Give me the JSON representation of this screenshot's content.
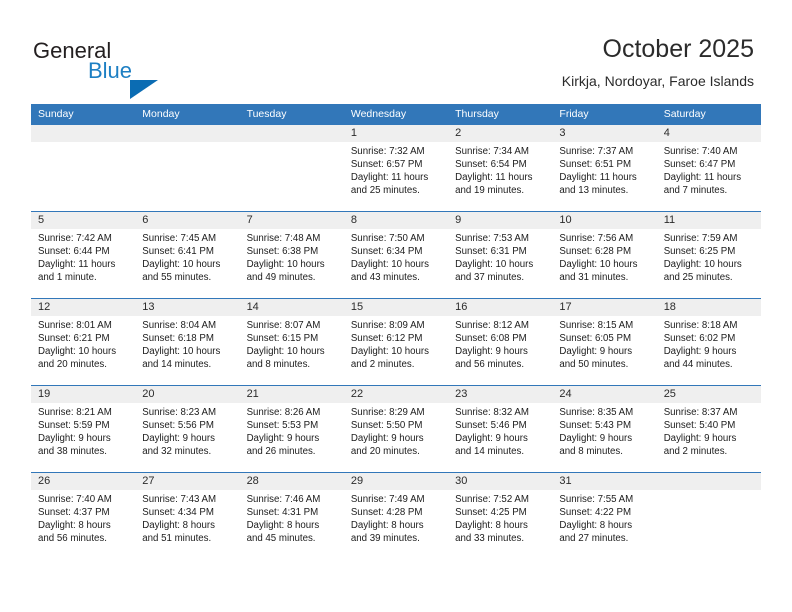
{
  "brand": {
    "name_part1": "General",
    "name_part2": "Blue",
    "logo_icon": "triangle-icon",
    "accent_color": "#1d7fc3",
    "triangle_color": "#0b6cb3"
  },
  "header": {
    "title": "October 2025",
    "subtitle": "Kirkja, Nordoyar, Faroe Islands"
  },
  "theme": {
    "header_blue": "#3277b9",
    "daynum_band": "#efefef",
    "text": "#1c1c1c"
  },
  "weekday_headers": [
    "Sunday",
    "Monday",
    "Tuesday",
    "Wednesday",
    "Thursday",
    "Friday",
    "Saturday"
  ],
  "weeks": [
    [
      {
        "day": "",
        "lines": []
      },
      {
        "day": "",
        "lines": []
      },
      {
        "day": "",
        "lines": []
      },
      {
        "day": "1",
        "lines": [
          "Sunrise: 7:32 AM",
          "Sunset: 6:57 PM",
          "Daylight: 11 hours",
          "and 25 minutes."
        ]
      },
      {
        "day": "2",
        "lines": [
          "Sunrise: 7:34 AM",
          "Sunset: 6:54 PM",
          "Daylight: 11 hours",
          "and 19 minutes."
        ]
      },
      {
        "day": "3",
        "lines": [
          "Sunrise: 7:37 AM",
          "Sunset: 6:51 PM",
          "Daylight: 11 hours",
          "and 13 minutes."
        ]
      },
      {
        "day": "4",
        "lines": [
          "Sunrise: 7:40 AM",
          "Sunset: 6:47 PM",
          "Daylight: 11 hours",
          "and 7 minutes."
        ]
      }
    ],
    [
      {
        "day": "5",
        "lines": [
          "Sunrise: 7:42 AM",
          "Sunset: 6:44 PM",
          "Daylight: 11 hours",
          "and 1 minute."
        ]
      },
      {
        "day": "6",
        "lines": [
          "Sunrise: 7:45 AM",
          "Sunset: 6:41 PM",
          "Daylight: 10 hours",
          "and 55 minutes."
        ]
      },
      {
        "day": "7",
        "lines": [
          "Sunrise: 7:48 AM",
          "Sunset: 6:38 PM",
          "Daylight: 10 hours",
          "and 49 minutes."
        ]
      },
      {
        "day": "8",
        "lines": [
          "Sunrise: 7:50 AM",
          "Sunset: 6:34 PM",
          "Daylight: 10 hours",
          "and 43 minutes."
        ]
      },
      {
        "day": "9",
        "lines": [
          "Sunrise: 7:53 AM",
          "Sunset: 6:31 PM",
          "Daylight: 10 hours",
          "and 37 minutes."
        ]
      },
      {
        "day": "10",
        "lines": [
          "Sunrise: 7:56 AM",
          "Sunset: 6:28 PM",
          "Daylight: 10 hours",
          "and 31 minutes."
        ]
      },
      {
        "day": "11",
        "lines": [
          "Sunrise: 7:59 AM",
          "Sunset: 6:25 PM",
          "Daylight: 10 hours",
          "and 25 minutes."
        ]
      }
    ],
    [
      {
        "day": "12",
        "lines": [
          "Sunrise: 8:01 AM",
          "Sunset: 6:21 PM",
          "Daylight: 10 hours",
          "and 20 minutes."
        ]
      },
      {
        "day": "13",
        "lines": [
          "Sunrise: 8:04 AM",
          "Sunset: 6:18 PM",
          "Daylight: 10 hours",
          "and 14 minutes."
        ]
      },
      {
        "day": "14",
        "lines": [
          "Sunrise: 8:07 AM",
          "Sunset: 6:15 PM",
          "Daylight: 10 hours",
          "and 8 minutes."
        ]
      },
      {
        "day": "15",
        "lines": [
          "Sunrise: 8:09 AM",
          "Sunset: 6:12 PM",
          "Daylight: 10 hours",
          "and 2 minutes."
        ]
      },
      {
        "day": "16",
        "lines": [
          "Sunrise: 8:12 AM",
          "Sunset: 6:08 PM",
          "Daylight: 9 hours",
          "and 56 minutes."
        ]
      },
      {
        "day": "17",
        "lines": [
          "Sunrise: 8:15 AM",
          "Sunset: 6:05 PM",
          "Daylight: 9 hours",
          "and 50 minutes."
        ]
      },
      {
        "day": "18",
        "lines": [
          "Sunrise: 8:18 AM",
          "Sunset: 6:02 PM",
          "Daylight: 9 hours",
          "and 44 minutes."
        ]
      }
    ],
    [
      {
        "day": "19",
        "lines": [
          "Sunrise: 8:21 AM",
          "Sunset: 5:59 PM",
          "Daylight: 9 hours",
          "and 38 minutes."
        ]
      },
      {
        "day": "20",
        "lines": [
          "Sunrise: 8:23 AM",
          "Sunset: 5:56 PM",
          "Daylight: 9 hours",
          "and 32 minutes."
        ]
      },
      {
        "day": "21",
        "lines": [
          "Sunrise: 8:26 AM",
          "Sunset: 5:53 PM",
          "Daylight: 9 hours",
          "and 26 minutes."
        ]
      },
      {
        "day": "22",
        "lines": [
          "Sunrise: 8:29 AM",
          "Sunset: 5:50 PM",
          "Daylight: 9 hours",
          "and 20 minutes."
        ]
      },
      {
        "day": "23",
        "lines": [
          "Sunrise: 8:32 AM",
          "Sunset: 5:46 PM",
          "Daylight: 9 hours",
          "and 14 minutes."
        ]
      },
      {
        "day": "24",
        "lines": [
          "Sunrise: 8:35 AM",
          "Sunset: 5:43 PM",
          "Daylight: 9 hours",
          "and 8 minutes."
        ]
      },
      {
        "day": "25",
        "lines": [
          "Sunrise: 8:37 AM",
          "Sunset: 5:40 PM",
          "Daylight: 9 hours",
          "and 2 minutes."
        ]
      }
    ],
    [
      {
        "day": "26",
        "lines": [
          "Sunrise: 7:40 AM",
          "Sunset: 4:37 PM",
          "Daylight: 8 hours",
          "and 56 minutes."
        ]
      },
      {
        "day": "27",
        "lines": [
          "Sunrise: 7:43 AM",
          "Sunset: 4:34 PM",
          "Daylight: 8 hours",
          "and 51 minutes."
        ]
      },
      {
        "day": "28",
        "lines": [
          "Sunrise: 7:46 AM",
          "Sunset: 4:31 PM",
          "Daylight: 8 hours",
          "and 45 minutes."
        ]
      },
      {
        "day": "29",
        "lines": [
          "Sunrise: 7:49 AM",
          "Sunset: 4:28 PM",
          "Daylight: 8 hours",
          "and 39 minutes."
        ]
      },
      {
        "day": "30",
        "lines": [
          "Sunrise: 7:52 AM",
          "Sunset: 4:25 PM",
          "Daylight: 8 hours",
          "and 33 minutes."
        ]
      },
      {
        "day": "31",
        "lines": [
          "Sunrise: 7:55 AM",
          "Sunset: 4:22 PM",
          "Daylight: 8 hours",
          "and 27 minutes."
        ]
      },
      {
        "day": "",
        "lines": []
      }
    ]
  ]
}
